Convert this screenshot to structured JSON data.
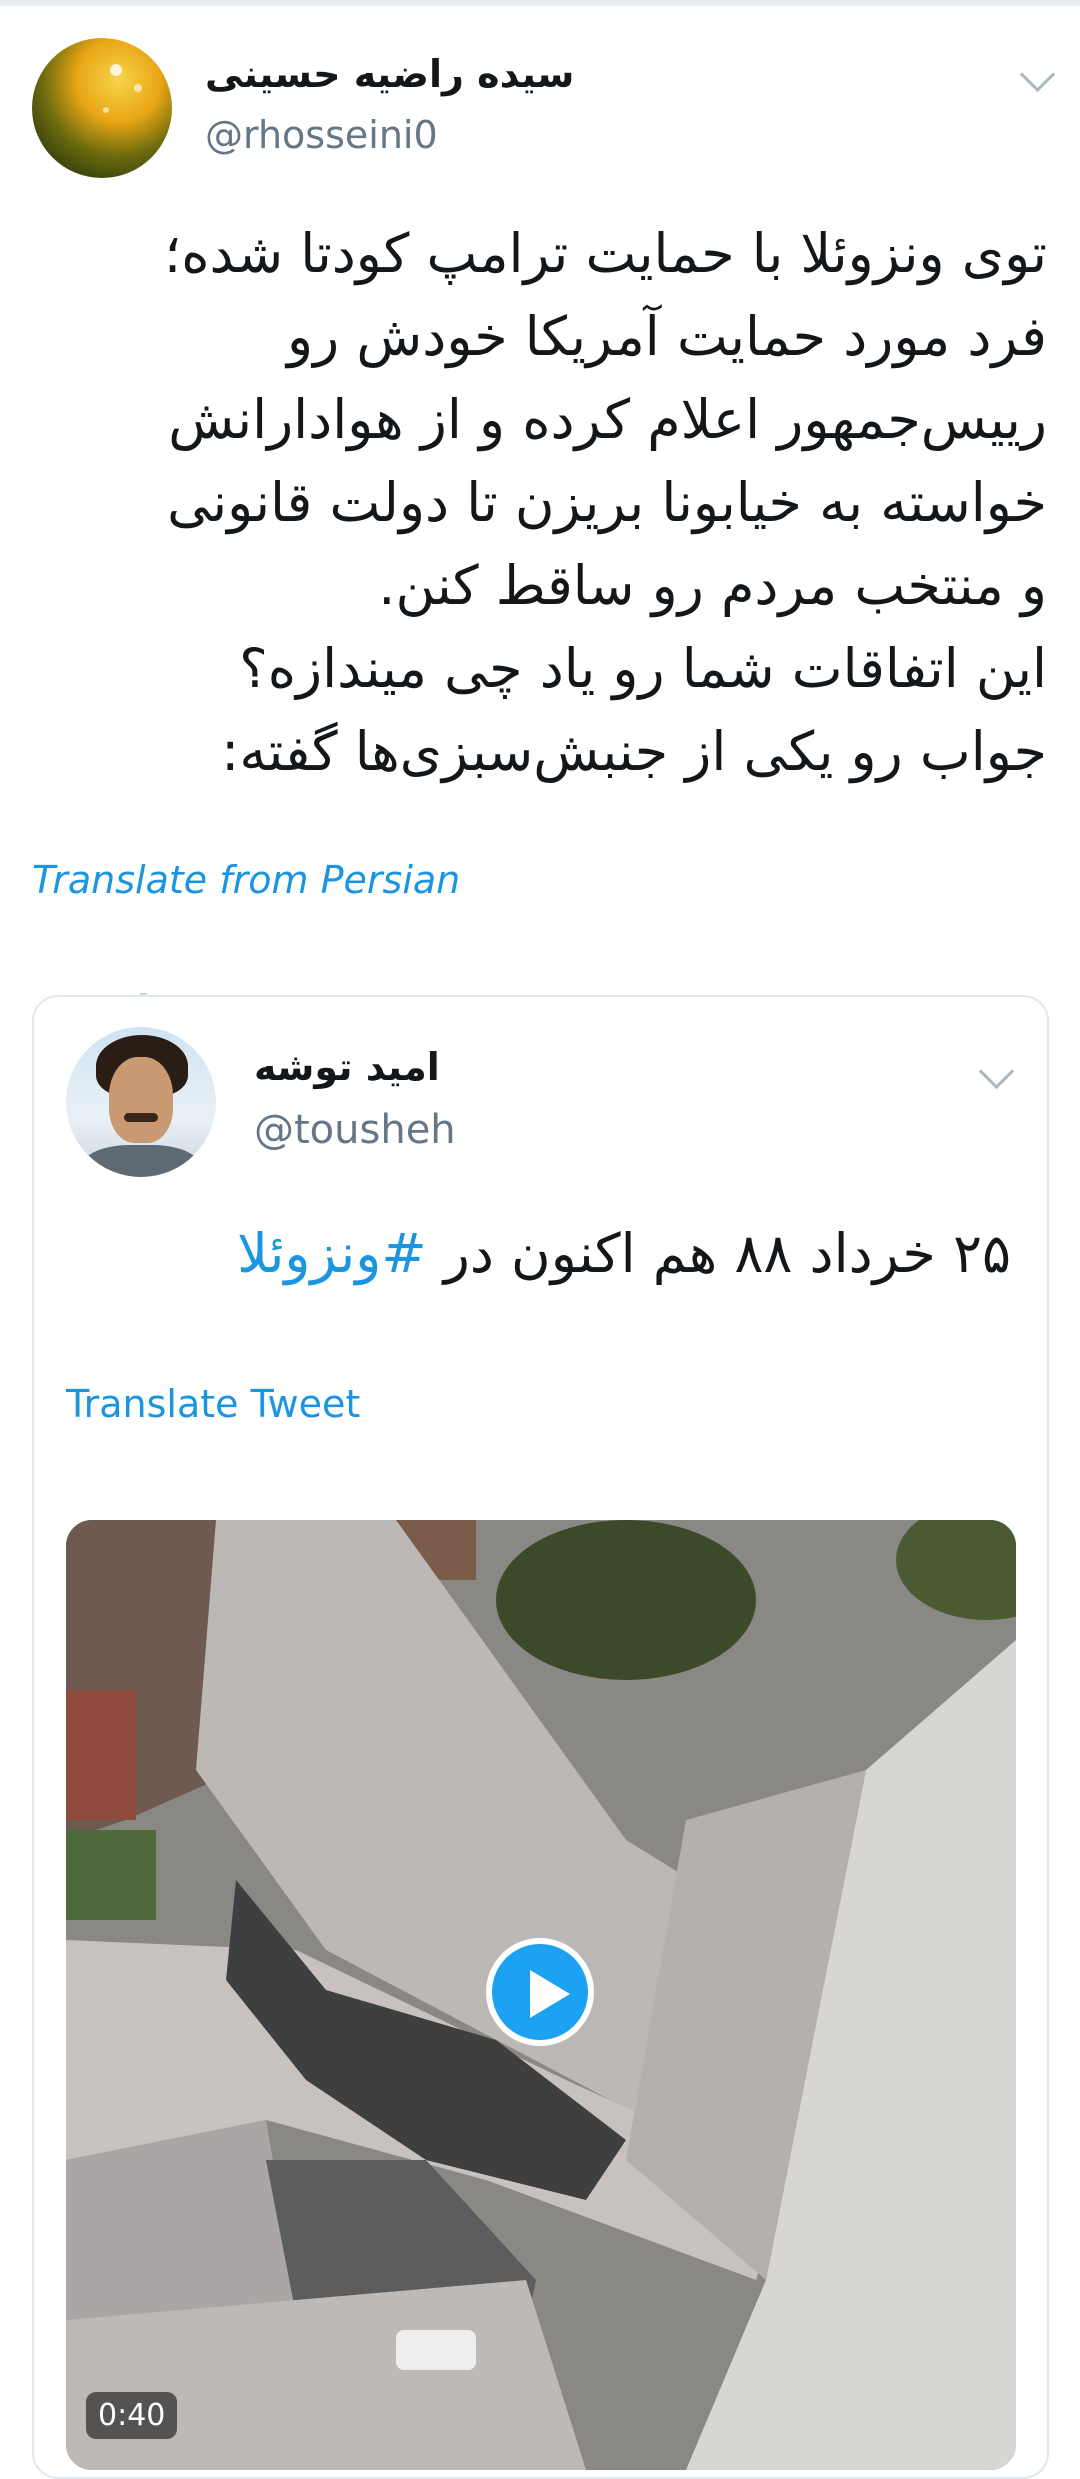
{
  "tweet": {
    "author_name": "سیده راضیه حسینی",
    "author_handle": "@rhosseini0",
    "text_lines": [
      "توی ونزوئلا با حمایت ترامپ کودتا شده؛",
      "فرد مورد حمایت آمریکا خودش رو",
      "رییس‌جمهور اعلام کرده و از هوادارانش",
      "خواسته به خیابونا بریزن تا دولت قانونی",
      "و منتخب مردم رو ساقط کنن.",
      "این اتفاقات شما رو یاد چی میندازه؟",
      "جواب رو یکی از  جنبش‌سبزی‌ها گفته:"
    ],
    "translate_label": "Translate from Persian",
    "menu_icon": "chevron-down-icon",
    "avatar_icon": "flower-photo"
  },
  "quoted": {
    "author_name": "امید توشه",
    "author_handle": "@tousheh",
    "text": "۲۵ خرداد ۸۸ هم اکنون در",
    "hashtag": "#ونزوئلا",
    "translate_label": "Translate Tweet",
    "menu_icon": "chevron-down-icon",
    "video": {
      "duration": "0:40",
      "play_icon": "play-icon"
    }
  },
  "colors": {
    "link": "#1b95e0",
    "text": "#14171a",
    "secondary": "#657786",
    "play_button": "#1da1f2"
  }
}
